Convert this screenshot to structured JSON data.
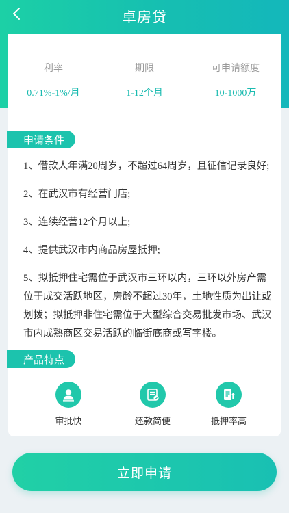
{
  "nav": {
    "title": "卓房贷"
  },
  "stats": [
    {
      "label": "利率",
      "value": "0.71%-1%/月"
    },
    {
      "label": "期限",
      "value": "1-12个月"
    },
    {
      "label": "可申请额度",
      "value": "10-1000万"
    }
  ],
  "conditions": {
    "heading": "申请条件",
    "items": [
      "1、借款人年满20周岁，不超过64周岁，且征信记录良好;",
      "2、在武汉市有经营门店;",
      "3、连续经营12个月以上;",
      "4、提供武汉市内商品房屋抵押;",
      "5、拟抵押住宅需位于武汉市三环以内，三环以外房产需位于成交活跃地区，房龄不超过30年，土地性质为出让或划拨；拟抵押非住宅需位于大型综合交易批发市场、武汉市内成熟商区交易活跃的临街底商或写字楼。"
    ]
  },
  "features": {
    "heading": "产品特点",
    "items": [
      {
        "label": "审批快",
        "icon": "approval-person-icon"
      },
      {
        "label": "还款简便",
        "icon": "repayment-document-icon"
      },
      {
        "label": "抵押率高",
        "icon": "mortgage-rate-icon"
      }
    ]
  },
  "apply_button": "立即申请",
  "colors": {
    "accent": "#1cc3ad",
    "value_text": "#1bbbb0"
  }
}
